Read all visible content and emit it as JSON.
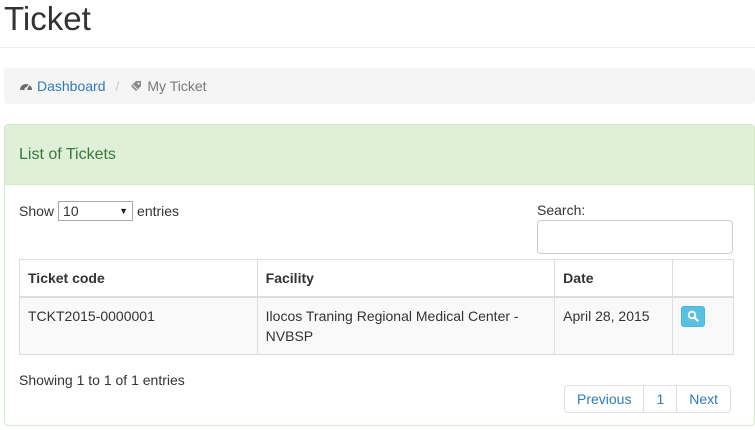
{
  "page": {
    "title": "Ticket"
  },
  "breadcrumb": [
    {
      "label": "Dashboard",
      "icon": "dashboard-icon"
    },
    {
      "label": "My Ticket",
      "icon": "ticket-icon"
    }
  ],
  "panel": {
    "title": "List of Tickets"
  },
  "length_control": {
    "show_label": "Show",
    "selected": "10",
    "entries_label": "entries"
  },
  "search": {
    "label": "Search:",
    "value": ""
  },
  "table": {
    "columns": [
      "Ticket code",
      "Facility",
      "Date",
      ""
    ],
    "rows": [
      {
        "ticket_code": "TCKT2015-0000001",
        "facility": "Ilocos Traning Regional Medical Center - NVBSP",
        "date": "April 28, 2015",
        "action_icon": "search-icon"
      }
    ]
  },
  "info": "Showing 1 to 1 of 1 entries",
  "pagination": {
    "previous": "Previous",
    "current": "1",
    "next": "Next"
  },
  "colors": {
    "link": "#337ab7",
    "panel_heading_bg": "#dff0d8",
    "panel_title": "#3c763d",
    "info_button": "#5bc0de"
  }
}
